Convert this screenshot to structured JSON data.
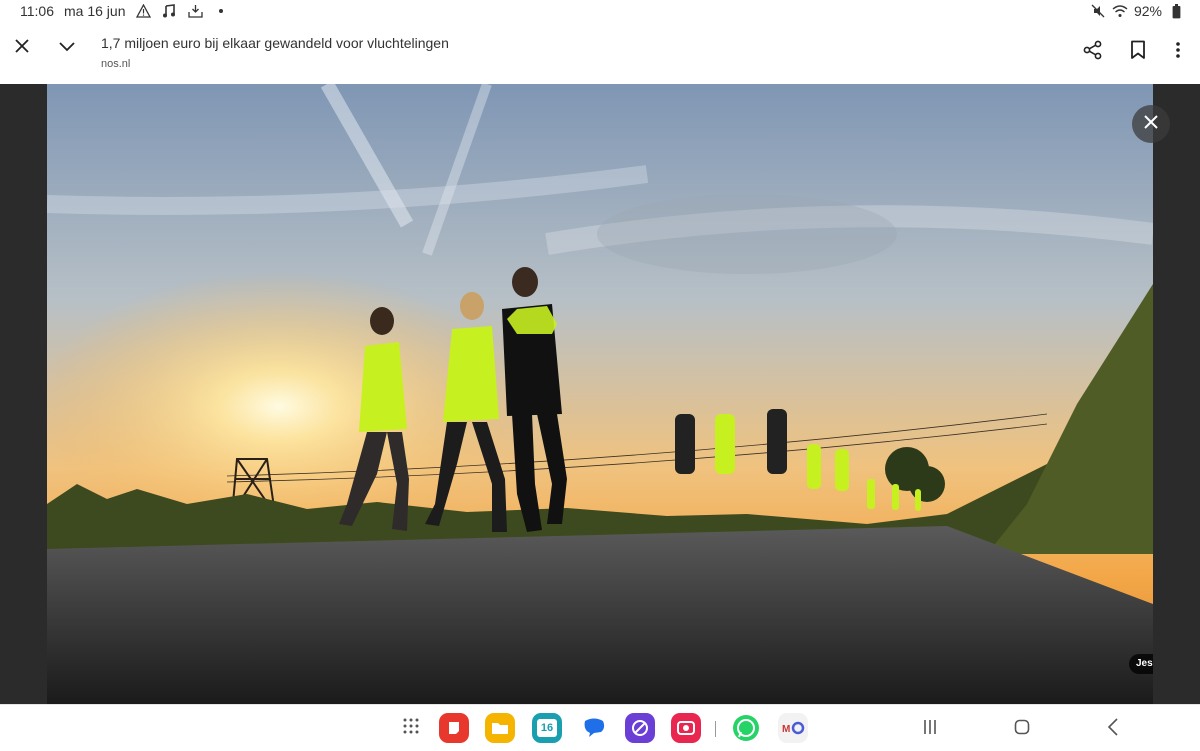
{
  "status_bar": {
    "time": "11:06",
    "date": "ma 16 jun",
    "left_icons": [
      "warning-icon",
      "music-note-icon",
      "download-tray-icon",
      "dot-icon"
    ],
    "right_icons": [
      "mute-icon",
      "wifi-icon",
      "battery-icon"
    ],
    "battery": "92%"
  },
  "header": {
    "title": "1,7 miljoen euro bij elkaar gewandeld voor vluchtelingen",
    "domain": "nos.nl",
    "icons": [
      "close-icon",
      "chevron-down-icon",
      "share-icon",
      "bookmark-icon",
      "more-vert-icon"
    ]
  },
  "media": {
    "photo_credit": "Jesse Wensing",
    "close_icon": "close-icon"
  },
  "dock": {
    "apps": [
      {
        "name": "app-grid",
        "color": "#ffffff"
      },
      {
        "name": "notes-app",
        "color": "#e8382e"
      },
      {
        "name": "my-files-app",
        "color": "#f5b400"
      },
      {
        "name": "calendar-app",
        "color": "#1a9fb0",
        "label": "16"
      },
      {
        "name": "messages-app",
        "color": "#ffffff"
      },
      {
        "name": "internet-app",
        "color": "#6b3fd6"
      },
      {
        "name": "gallery-app",
        "color": "#e8264f"
      },
      {
        "name": "whatsapp-app",
        "color": "#25d366"
      },
      {
        "name": "recent-apps-app",
        "color": "#f2f2f2"
      }
    ]
  },
  "system_nav": [
    "recents-icon",
    "home-icon",
    "back-icon"
  ]
}
